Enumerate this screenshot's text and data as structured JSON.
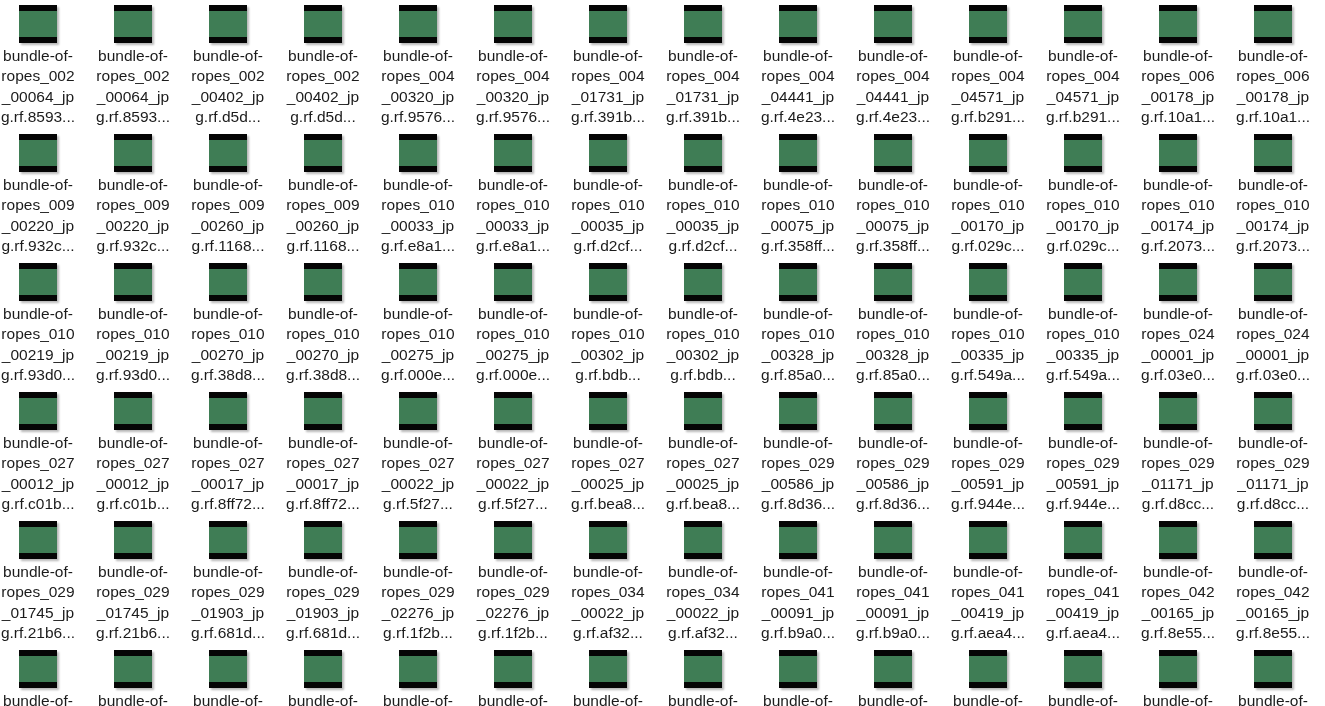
{
  "files": [
    {
      "name_lines": [
        "bundle-of-",
        "ropes_002",
        "_00064_jp",
        "g.rf.8593..."
      ]
    },
    {
      "name_lines": [
        "bundle-of-",
        "ropes_002",
        "_00064_jp",
        "g.rf.8593..."
      ]
    },
    {
      "name_lines": [
        "bundle-of-",
        "ropes_002",
        "_00402_jp",
        "g.rf.d5d..."
      ]
    },
    {
      "name_lines": [
        "bundle-of-",
        "ropes_002",
        "_00402_jp",
        "g.rf.d5d..."
      ]
    },
    {
      "name_lines": [
        "bundle-of-",
        "ropes_004",
        "_00320_jp",
        "g.rf.9576..."
      ]
    },
    {
      "name_lines": [
        "bundle-of-",
        "ropes_004",
        "_00320_jp",
        "g.rf.9576..."
      ]
    },
    {
      "name_lines": [
        "bundle-of-",
        "ropes_004",
        "_01731_jp",
        "g.rf.391b..."
      ]
    },
    {
      "name_lines": [
        "bundle-of-",
        "ropes_004",
        "_01731_jp",
        "g.rf.391b..."
      ]
    },
    {
      "name_lines": [
        "bundle-of-",
        "ropes_004",
        "_04441_jp",
        "g.rf.4e23..."
      ]
    },
    {
      "name_lines": [
        "bundle-of-",
        "ropes_004",
        "_04441_jp",
        "g.rf.4e23..."
      ]
    },
    {
      "name_lines": [
        "bundle-of-",
        "ropes_004",
        "_04571_jp",
        "g.rf.b291..."
      ]
    },
    {
      "name_lines": [
        "bundle-of-",
        "ropes_004",
        "_04571_jp",
        "g.rf.b291..."
      ]
    },
    {
      "name_lines": [
        "bundle-of-",
        "ropes_006",
        "_00178_jp",
        "g.rf.10a1..."
      ]
    },
    {
      "name_lines": [
        "bundle-of-",
        "ropes_006",
        "_00178_jp",
        "g.rf.10a1..."
      ]
    },
    {
      "name_lines": [
        "bundle-of-",
        "ropes_009",
        "_00220_jp",
        "g.rf.932c..."
      ]
    },
    {
      "name_lines": [
        "bundle-of-",
        "ropes_009",
        "_00220_jp",
        "g.rf.932c..."
      ]
    },
    {
      "name_lines": [
        "bundle-of-",
        "ropes_009",
        "_00260_jp",
        "g.rf.1168..."
      ]
    },
    {
      "name_lines": [
        "bundle-of-",
        "ropes_009",
        "_00260_jp",
        "g.rf.1168..."
      ]
    },
    {
      "name_lines": [
        "bundle-of-",
        "ropes_010",
        "_00033_jp",
        "g.rf.e8a1..."
      ]
    },
    {
      "name_lines": [
        "bundle-of-",
        "ropes_010",
        "_00033_jp",
        "g.rf.e8a1..."
      ]
    },
    {
      "name_lines": [
        "bundle-of-",
        "ropes_010",
        "_00035_jp",
        "g.rf.d2cf..."
      ]
    },
    {
      "name_lines": [
        "bundle-of-",
        "ropes_010",
        "_00035_jp",
        "g.rf.d2cf..."
      ]
    },
    {
      "name_lines": [
        "bundle-of-",
        "ropes_010",
        "_00075_jp",
        "g.rf.358ff..."
      ]
    },
    {
      "name_lines": [
        "bundle-of-",
        "ropes_010",
        "_00075_jp",
        "g.rf.358ff..."
      ]
    },
    {
      "name_lines": [
        "bundle-of-",
        "ropes_010",
        "_00170_jp",
        "g.rf.029c..."
      ]
    },
    {
      "name_lines": [
        "bundle-of-",
        "ropes_010",
        "_00170_jp",
        "g.rf.029c..."
      ]
    },
    {
      "name_lines": [
        "bundle-of-",
        "ropes_010",
        "_00174_jp",
        "g.rf.2073..."
      ]
    },
    {
      "name_lines": [
        "bundle-of-",
        "ropes_010",
        "_00174_jp",
        "g.rf.2073..."
      ]
    },
    {
      "name_lines": [
        "bundle-of-",
        "ropes_010",
        "_00219_jp",
        "g.rf.93d0..."
      ]
    },
    {
      "name_lines": [
        "bundle-of-",
        "ropes_010",
        "_00219_jp",
        "g.rf.93d0..."
      ]
    },
    {
      "name_lines": [
        "bundle-of-",
        "ropes_010",
        "_00270_jp",
        "g.rf.38d8..."
      ]
    },
    {
      "name_lines": [
        "bundle-of-",
        "ropes_010",
        "_00270_jp",
        "g.rf.38d8..."
      ]
    },
    {
      "name_lines": [
        "bundle-of-",
        "ropes_010",
        "_00275_jp",
        "g.rf.000e..."
      ]
    },
    {
      "name_lines": [
        "bundle-of-",
        "ropes_010",
        "_00275_jp",
        "g.rf.000e..."
      ]
    },
    {
      "name_lines": [
        "bundle-of-",
        "ropes_010",
        "_00302_jp",
        "g.rf.bdb..."
      ]
    },
    {
      "name_lines": [
        "bundle-of-",
        "ropes_010",
        "_00302_jp",
        "g.rf.bdb..."
      ]
    },
    {
      "name_lines": [
        "bundle-of-",
        "ropes_010",
        "_00328_jp",
        "g.rf.85a0..."
      ]
    },
    {
      "name_lines": [
        "bundle-of-",
        "ropes_010",
        "_00328_jp",
        "g.rf.85a0..."
      ]
    },
    {
      "name_lines": [
        "bundle-of-",
        "ropes_010",
        "_00335_jp",
        "g.rf.549a..."
      ]
    },
    {
      "name_lines": [
        "bundle-of-",
        "ropes_010",
        "_00335_jp",
        "g.rf.549a..."
      ]
    },
    {
      "name_lines": [
        "bundle-of-",
        "ropes_024",
        "_00001_jp",
        "g.rf.03e0..."
      ]
    },
    {
      "name_lines": [
        "bundle-of-",
        "ropes_024",
        "_00001_jp",
        "g.rf.03e0..."
      ]
    },
    {
      "name_lines": [
        "bundle-of-",
        "ropes_027",
        "_00012_jp",
        "g.rf.c01b..."
      ]
    },
    {
      "name_lines": [
        "bundle-of-",
        "ropes_027",
        "_00012_jp",
        "g.rf.c01b..."
      ]
    },
    {
      "name_lines": [
        "bundle-of-",
        "ropes_027",
        "_00017_jp",
        "g.rf.8ff72..."
      ]
    },
    {
      "name_lines": [
        "bundle-of-",
        "ropes_027",
        "_00017_jp",
        "g.rf.8ff72..."
      ]
    },
    {
      "name_lines": [
        "bundle-of-",
        "ropes_027",
        "_00022_jp",
        "g.rf.5f27..."
      ]
    },
    {
      "name_lines": [
        "bundle-of-",
        "ropes_027",
        "_00022_jp",
        "g.rf.5f27..."
      ]
    },
    {
      "name_lines": [
        "bundle-of-",
        "ropes_027",
        "_00025_jp",
        "g.rf.bea8..."
      ]
    },
    {
      "name_lines": [
        "bundle-of-",
        "ropes_027",
        "_00025_jp",
        "g.rf.bea8..."
      ]
    },
    {
      "name_lines": [
        "bundle-of-",
        "ropes_029",
        "_00586_jp",
        "g.rf.8d36..."
      ]
    },
    {
      "name_lines": [
        "bundle-of-",
        "ropes_029",
        "_00586_jp",
        "g.rf.8d36..."
      ]
    },
    {
      "name_lines": [
        "bundle-of-",
        "ropes_029",
        "_00591_jp",
        "g.rf.944e..."
      ]
    },
    {
      "name_lines": [
        "bundle-of-",
        "ropes_029",
        "_00591_jp",
        "g.rf.944e..."
      ]
    },
    {
      "name_lines": [
        "bundle-of-",
        "ropes_029",
        "_01171_jp",
        "g.rf.d8cc..."
      ]
    },
    {
      "name_lines": [
        "bundle-of-",
        "ropes_029",
        "_01171_jp",
        "g.rf.d8cc..."
      ]
    },
    {
      "name_lines": [
        "bundle-of-",
        "ropes_029",
        "_01745_jp",
        "g.rf.21b6..."
      ]
    },
    {
      "name_lines": [
        "bundle-of-",
        "ropes_029",
        "_01745_jp",
        "g.rf.21b6..."
      ]
    },
    {
      "name_lines": [
        "bundle-of-",
        "ropes_029",
        "_01903_jp",
        "g.rf.681d..."
      ]
    },
    {
      "name_lines": [
        "bundle-of-",
        "ropes_029",
        "_01903_jp",
        "g.rf.681d..."
      ]
    },
    {
      "name_lines": [
        "bundle-of-",
        "ropes_029",
        "_02276_jp",
        "g.rf.1f2b..."
      ]
    },
    {
      "name_lines": [
        "bundle-of-",
        "ropes_029",
        "_02276_jp",
        "g.rf.1f2b..."
      ]
    },
    {
      "name_lines": [
        "bundle-of-",
        "ropes_034",
        "_00022_jp",
        "g.rf.af32..."
      ]
    },
    {
      "name_lines": [
        "bundle-of-",
        "ropes_034",
        "_00022_jp",
        "g.rf.af32..."
      ]
    },
    {
      "name_lines": [
        "bundle-of-",
        "ropes_041",
        "_00091_jp",
        "g.rf.b9a0..."
      ]
    },
    {
      "name_lines": [
        "bundle-of-",
        "ropes_041",
        "_00091_jp",
        "g.rf.b9a0..."
      ]
    },
    {
      "name_lines": [
        "bundle-of-",
        "ropes_041",
        "_00419_jp",
        "g.rf.aea4..."
      ]
    },
    {
      "name_lines": [
        "bundle-of-",
        "ropes_041",
        "_00419_jp",
        "g.rf.aea4..."
      ]
    },
    {
      "name_lines": [
        "bundle-of-",
        "ropes_042",
        "_00165_jp",
        "g.rf.8e55..."
      ]
    },
    {
      "name_lines": [
        "bundle-of-",
        "ropes_042",
        "_00165_jp",
        "g.rf.8e55..."
      ]
    },
    {
      "name_lines": [
        "bundle-of-"
      ]
    },
    {
      "name_lines": [
        "bundle-of-"
      ]
    },
    {
      "name_lines": [
        "bundle-of-"
      ]
    },
    {
      "name_lines": [
        "bundle-of-"
      ]
    },
    {
      "name_lines": [
        "bundle-of-"
      ]
    },
    {
      "name_lines": [
        "bundle-of-"
      ]
    },
    {
      "name_lines": [
        "bundle-of-"
      ]
    },
    {
      "name_lines": [
        "bundle-of-"
      ]
    },
    {
      "name_lines": [
        "bundle-of-"
      ]
    },
    {
      "name_lines": [
        "bundle-of-"
      ]
    },
    {
      "name_lines": [
        "bundle-of-"
      ]
    },
    {
      "name_lines": [
        "bundle-of-"
      ]
    },
    {
      "name_lines": [
        "bundle-of-"
      ]
    },
    {
      "name_lines": [
        "bundle-of-"
      ]
    }
  ]
}
